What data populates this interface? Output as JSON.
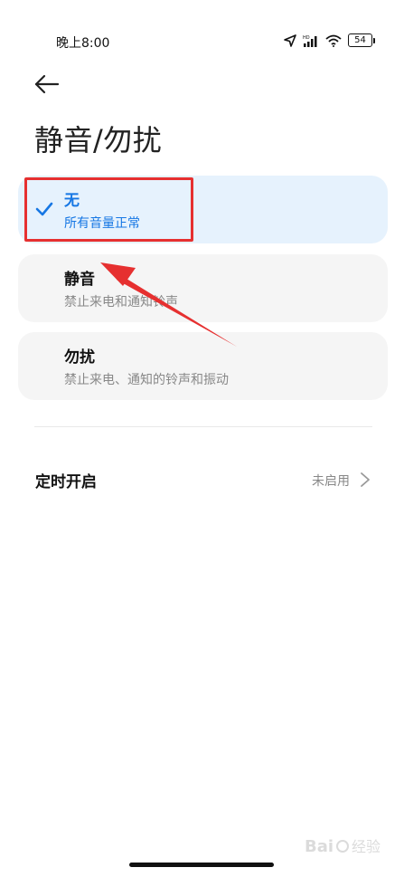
{
  "status_bar": {
    "time": "晚上8:00",
    "battery_level": "54",
    "icons": [
      "location-icon",
      "signal-icon",
      "wifi-icon",
      "battery-icon"
    ]
  },
  "header": {
    "back_icon": "arrow-left-icon",
    "title": "静音/勿扰"
  },
  "options": [
    {
      "title": "无",
      "subtitle": "所有音量正常",
      "selected": true
    },
    {
      "title": "静音",
      "subtitle": "禁止来电和通知铃声",
      "selected": false
    },
    {
      "title": "勿扰",
      "subtitle": "禁止来电、通知的铃声和振动",
      "selected": false
    }
  ],
  "schedule": {
    "label": "定时开启",
    "value": "未启用"
  },
  "colors": {
    "accent": "#1677e4",
    "selected_bg": "#e6f2fd",
    "card_bg": "#f5f5f5",
    "annotation_red": "#e63030"
  },
  "watermark": {
    "text": "Bai 经验"
  }
}
